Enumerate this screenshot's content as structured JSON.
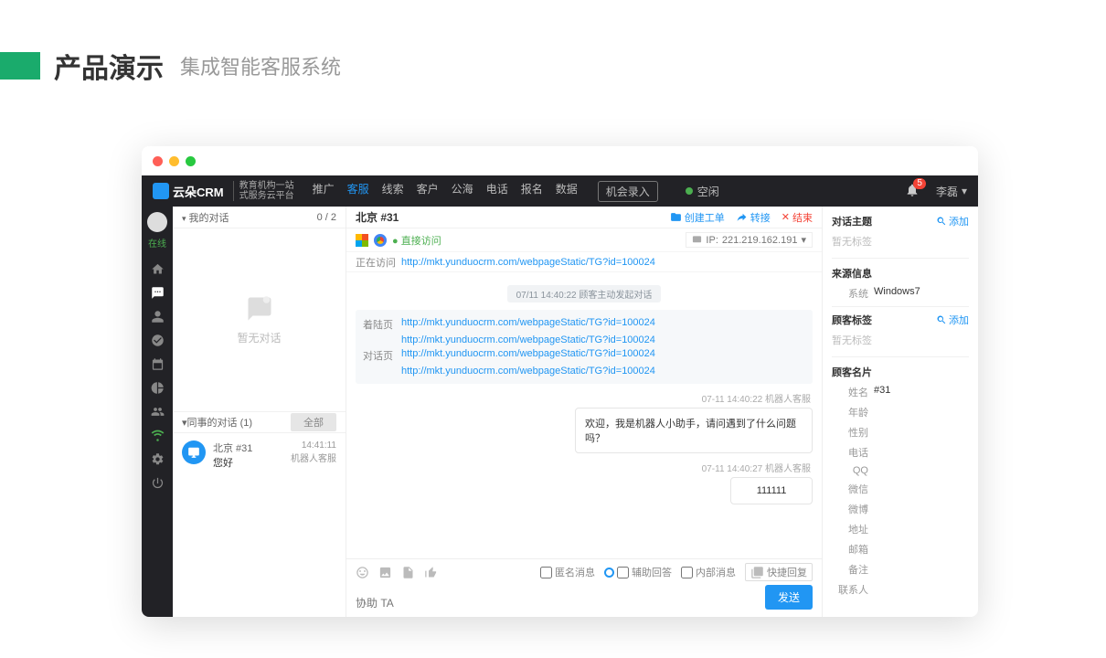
{
  "slide": {
    "title_main": "产品演示",
    "title_sub": "集成智能客服系统"
  },
  "nav": {
    "logo": "云朵CRM",
    "logo_sub1": "教育机构一站",
    "logo_sub2": "式服务云平台",
    "items": [
      "推广",
      "客服",
      "线索",
      "客户",
      "公海",
      "电话",
      "报名",
      "数据"
    ],
    "active_index": 1,
    "record_btn": "机会录入",
    "status": "空闲",
    "badge": "5",
    "username": "李磊"
  },
  "rail": {
    "status": "在线"
  },
  "conv": {
    "my_title": "我的对话",
    "my_count": "0 / 2",
    "empty": "暂无对话",
    "peer_title": "同事的对话  (1)",
    "tab_all": "全部",
    "item": {
      "name": "北京 #31",
      "msg": "您好",
      "time": "14:41:11",
      "agent": "机器人客服"
    }
  },
  "chat": {
    "title": "北京 #31",
    "action_ticket": "创建工单",
    "action_transfer": "转接",
    "action_end": "结束",
    "direct": "直接访问",
    "ip_label": "IP: ",
    "ip": "221.219.162.191",
    "visiting_label": "正在访问",
    "visiting_url": "http://mkt.yunduocrm.com/webpageStatic/TG?id=100024",
    "center_ts": "07/11 14:40:22  顾客主动发起对话",
    "landing_label": "着陆页",
    "landing_urls": [
      "http://mkt.yunduocrm.com/webpageStatic/TG?id=100024",
      "http://mkt.yunduocrm.com/webpageStatic/TG?id=100024"
    ],
    "dialog_label": "对话页",
    "dialog_urls": [
      "http://mkt.yunduocrm.com/webpageStatic/TG?id=100024",
      "http://mkt.yunduocrm.com/webpageStatic/TG?id=100024"
    ],
    "bot_ts1": "07-11 14:40:22  机器人客服",
    "bot_msg": "欢迎，我是机器人小助手，请问遇到了什么问题吗？",
    "bot_ts2": "07-11 14:40:27  机器人客服",
    "bot_msg2": "111111",
    "opt_anon": "匿名消息",
    "opt_assist": "辅助回答",
    "opt_internal": "内部消息",
    "opt_quick": "快捷回复",
    "placeholder": "协助 TA",
    "send": "发送"
  },
  "side": {
    "subject_title": "对话主题",
    "add": "添加",
    "none": "暂无标签",
    "source_title": "来源信息",
    "system_label": "系统",
    "system_value": "Windows7",
    "tags_title": "顾客标签",
    "tags_none": "暂无标签",
    "card_title": "顾客名片",
    "fields": [
      {
        "k": "姓名",
        "v": "#31"
      },
      {
        "k": "年龄",
        "v": ""
      },
      {
        "k": "性别",
        "v": ""
      },
      {
        "k": "电话",
        "v": ""
      },
      {
        "k": "QQ",
        "v": ""
      },
      {
        "k": "微信",
        "v": ""
      },
      {
        "k": "微博",
        "v": ""
      },
      {
        "k": "地址",
        "v": ""
      },
      {
        "k": "邮箱",
        "v": ""
      },
      {
        "k": "备注",
        "v": ""
      },
      {
        "k": "联系人",
        "v": ""
      }
    ]
  }
}
